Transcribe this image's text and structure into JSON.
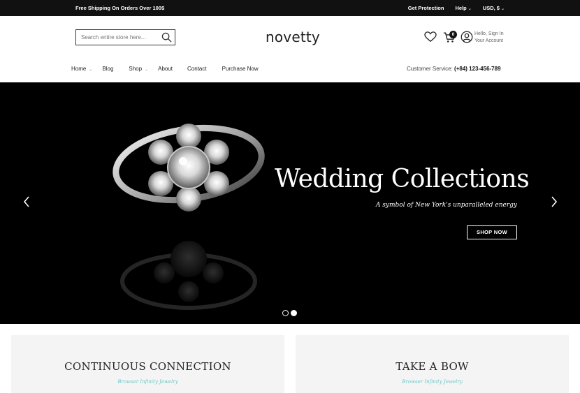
{
  "topbar": {
    "promo": "Free Shipping On Orders Over 100$",
    "links": [
      "Get Protection",
      "Help",
      "USD, $"
    ]
  },
  "header": {
    "search_placeholder": "Search entire store here...",
    "logo": "novetty",
    "cart_count": "0",
    "account_line1": "Hello, Sign In",
    "account_line2": "Your Account"
  },
  "nav": {
    "items": [
      "Home",
      "Blog",
      "Shop",
      "About",
      "Contact",
      "Purchase Now"
    ],
    "service_label": "Customer Service:",
    "service_phone": "(+84) 123-456-789"
  },
  "hero": {
    "title": "Wedding Collections",
    "subtitle": "A symbol of New York's unparalleled energy",
    "button": "SHOP NOW",
    "slides": 2,
    "active_slide": 2
  },
  "promos": [
    {
      "title": "CONTINUOUS CONNECTION",
      "subtitle": "Browser Infinity Jewelry"
    },
    {
      "title": "TAKE A BOW",
      "subtitle": "Browser Infinity Jewelry"
    }
  ],
  "colors": {
    "topbar_bg": "#111111",
    "hero_bg": "#000000",
    "promo_bg": "#f4f4f4",
    "accent_teal": "#6cc8c8"
  }
}
